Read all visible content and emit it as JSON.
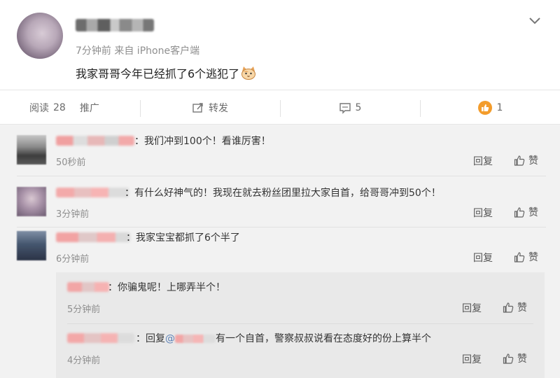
{
  "post": {
    "meta": "7分钟前 来自 iPhone客户端",
    "text": "我家哥哥今年已经抓了6个逃犯了",
    "emoji": "cat-emoji"
  },
  "actions": {
    "read_label": "阅读",
    "read_count": "28",
    "promote_label": "推广",
    "repost_label": "转发",
    "comment_count": "5",
    "like_count": "1"
  },
  "comments": [
    {
      "text": "：我们冲到100个！看谁厉害！",
      "time": "50秒前",
      "reply": "回复",
      "like": "赞"
    },
    {
      "text": "：有什么好神气的！我现在就去粉丝团里拉大家自首，给哥哥冲到50个！",
      "time": "3分钟前",
      "reply": "回复",
      "like": "赞"
    },
    {
      "text": "：我家宝宝都抓了6个半了",
      "time": "6分钟前",
      "reply": "回复",
      "like": "赞"
    }
  ],
  "subcomments": [
    {
      "text": "：你骗鬼呢！上哪弄半个！",
      "time": "5分钟前",
      "reply": "回复",
      "like": "赞"
    },
    {
      "prefix": "：回复",
      "mention": "@",
      "text": "有一个自首，警察叔叔说看在态度好的份上算半个",
      "time": "4分钟前",
      "reply": "回复",
      "like": "赞"
    }
  ],
  "colors": {
    "accent_link": "#5a7fb5",
    "like_orange": "#f39c2b",
    "comments_bg": "#f2f2f2",
    "subbox_bg": "#e9e9e9"
  }
}
